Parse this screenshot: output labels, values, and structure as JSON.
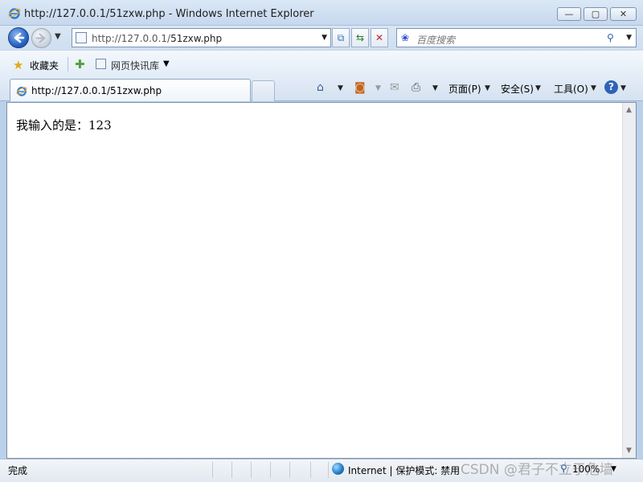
{
  "window": {
    "title": "http://127.0.0.1/51zxw.php - Windows Internet Explorer",
    "controls": {
      "minimize": "▭",
      "maximize": "▫",
      "close": "✕"
    }
  },
  "nav": {
    "address_host": "http://127.0.0.1/",
    "address_path": "51zxw.php",
    "search_placeholder": "百度搜索",
    "search_logo": "❀"
  },
  "favorites_bar": {
    "favorites_label": "收藏夹",
    "web_slice_label": "网页快讯库"
  },
  "tabs": [
    {
      "label": "http://127.0.0.1/51zxw.php"
    }
  ],
  "command_bar": {
    "page_menu": "页面(P)",
    "safety_menu": "安全(S)",
    "tools_menu": "工具(O)",
    "help_icon": "?"
  },
  "page": {
    "body_text": "我输入的是：123"
  },
  "status_bar": {
    "status": "完成",
    "zone": "Internet | 保护模式: 禁用",
    "zoom": "100%"
  },
  "watermark": "CSDN @君子不立于危墙"
}
